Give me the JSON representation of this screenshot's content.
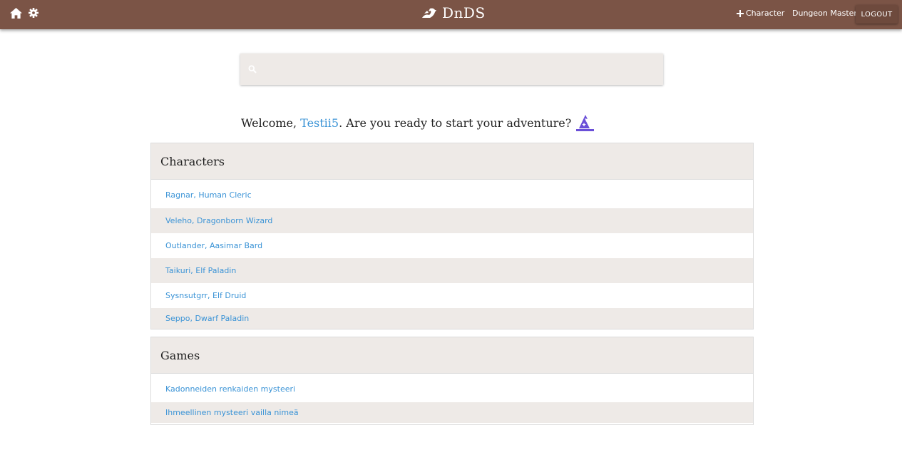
{
  "navbar": {
    "brand": "DnDS",
    "add_character": "Character",
    "dungeon_master": "Dungeon Master",
    "logout": "LOGOUT",
    "icons": {
      "home": "home-icon",
      "settings": "gear-icon",
      "brand_logo": "dragon-logo-icon",
      "add": "plus-icon"
    },
    "color": "#7b5446"
  },
  "search": {
    "placeholder": "",
    "value": ""
  },
  "welcome": {
    "prefix": "Welcome, ",
    "username": "Testii5",
    "suffix": ". Are you ready to start your adventure?",
    "icon": "wizard-hat-icon"
  },
  "characters": {
    "title": "Characters",
    "items": [
      "Ragnar, Human Cleric",
      "Veleho, Dragonborn Wizard",
      "Outlander, Aasimar Bard",
      "Taikuri, Elf Paladin",
      "Sysnsutgrr, Elf Druid",
      "Seppo, Dwarf Paladin"
    ]
  },
  "games": {
    "title": "Games",
    "items": [
      "Kadonneiden renkaiden mysteeri",
      "Ihmeellinen mysteeri vailla nimeä"
    ]
  },
  "colors": {
    "link": "#3a93d6",
    "panel_bg": "#eeeae7",
    "wizard_icon": "#6a4fd8"
  }
}
